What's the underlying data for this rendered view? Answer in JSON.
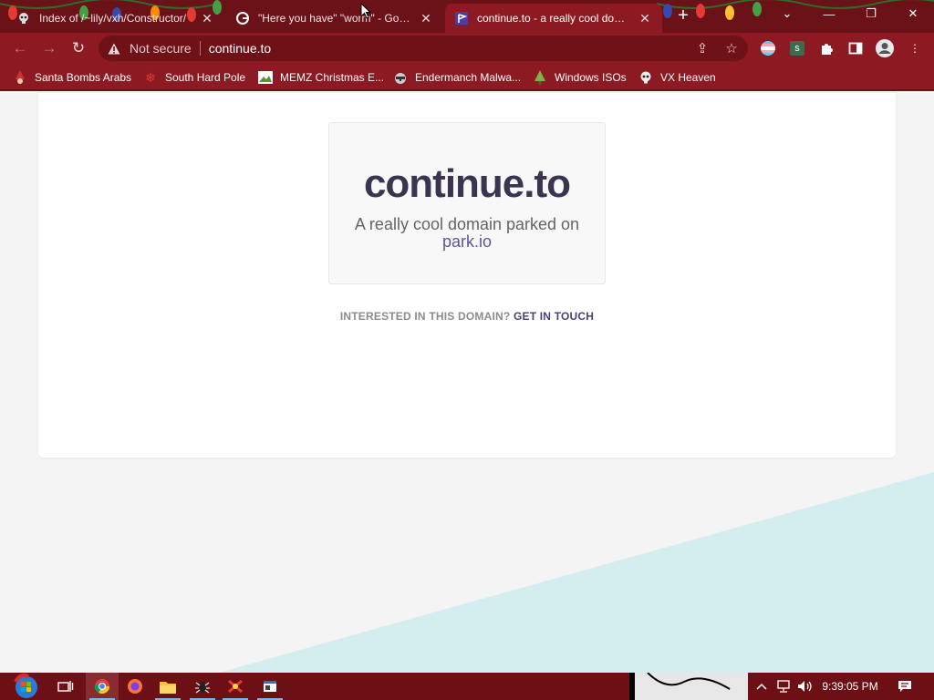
{
  "tabs": [
    {
      "title": "Index of /~lily/vxh/Constructor/",
      "active": false
    },
    {
      "title": "\"Here you have\" \"worm\" - Google",
      "active": false
    },
    {
      "title": "continue.to - a really cool domain",
      "active": true
    }
  ],
  "address_bar": {
    "security": "Not secure",
    "url": "continue.to"
  },
  "bookmarks": [
    {
      "label": "Santa Bombs Arabs",
      "icon": "santa-icon"
    },
    {
      "label": "South Hard Pole",
      "icon": "snowflake-icon"
    },
    {
      "label": "MEMZ Christmas E...",
      "icon": "image-icon"
    },
    {
      "label": "Endermanch Malwa...",
      "icon": "raccoon-icon"
    },
    {
      "label": "Windows ISOs",
      "icon": "tree-icon"
    },
    {
      "label": "VX Heaven",
      "icon": "skull-icon"
    }
  ],
  "page": {
    "domain": "continue.to",
    "tagline": "A really cool domain parked on",
    "park_link": "park.io",
    "interest_text": "INTERESTED IN THIS DOMAIN?",
    "cta": "GET IN TOUCH"
  },
  "extensions": {
    "s_label": "s"
  },
  "taskbar": {
    "clock": "9:39:05 PM"
  },
  "colors": {
    "frame": "#6b1218",
    "toolbar": "#8d1a22",
    "domain_text": "#3b3450",
    "cta": "#4d4079",
    "wedge": "#d4eef0"
  }
}
